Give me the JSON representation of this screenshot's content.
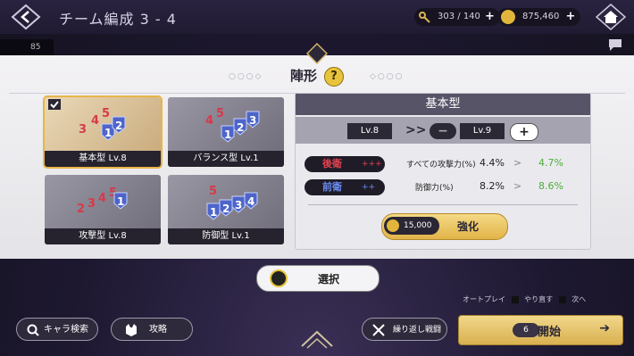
{
  "header": {
    "title": "チーム編成 3 - 4",
    "keys": "303 / 140",
    "coins": "875,460",
    "player_count": "85"
  },
  "modal": {
    "title": "陣形",
    "help": "?",
    "formations": [
      {
        "label": "基本型 Lv.8",
        "selected": true
      },
      {
        "label": "バランス型 Lv.1",
        "selected": false
      },
      {
        "label": "攻撃型 Lv.8",
        "selected": false
      },
      {
        "label": "防御型 Lv.1",
        "selected": false
      }
    ],
    "detail": {
      "name": "基本型",
      "level_current": "Lv.8",
      "level_next": "Lv.9",
      "arrows": ">>",
      "minus": "−",
      "plus": "+",
      "stats": [
        {
          "position": "後衛",
          "marks": "+++",
          "stat": "すべての攻撃力(%)",
          "current": "4.4%",
          "next": "4.7%",
          "color": "#e0424f"
        },
        {
          "position": "前衛",
          "marks": "++",
          "stat": "防御力(%)",
          "current": "8.2%",
          "next": "8.6%",
          "color": "#5a7ee8"
        }
      ],
      "upgrade_cost": "15,000",
      "upgrade_label": "強化"
    },
    "select_label": "選択"
  },
  "bottom": {
    "chara_search": "キャラ検索",
    "attack": "攻略",
    "repeat_battle": "繰り返し戦闘",
    "auto_play": "オートプレイ",
    "retry": "やり直す",
    "next": "次へ",
    "stamina_cost": "6",
    "start": "開始"
  }
}
